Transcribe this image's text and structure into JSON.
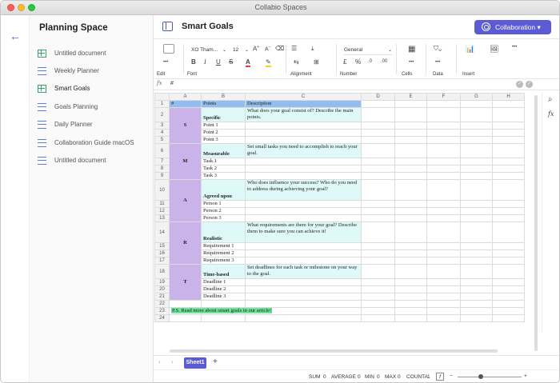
{
  "window": {
    "title": "Collabio Spaces"
  },
  "sidebar": {
    "title": "Planning Space",
    "items": [
      {
        "label": "Untitled document",
        "icon": "sheet-icon"
      },
      {
        "label": "Weekly Planner",
        "icon": "doc-icon"
      },
      {
        "label": "Smart Goals",
        "icon": "sheet-icon"
      },
      {
        "label": "Goals Planning",
        "icon": "doc-icon"
      },
      {
        "label": "Daily Planner",
        "icon": "doc-icon"
      },
      {
        "label": "Collaboration Guide macOS",
        "icon": "doc-icon"
      },
      {
        "label": "Untitled document",
        "icon": "doc-icon"
      }
    ]
  },
  "header": {
    "title": "Smart Goals",
    "collab_label": "Collaboration ▾"
  },
  "toolbar": {
    "edit": "Edit",
    "font": "Font",
    "alignment": "Alignment",
    "number": "Number",
    "cells": "Cells",
    "data": "Data",
    "insert": "Insert",
    "font_name": "XO Tham...",
    "font_size": "12",
    "number_format": "General",
    "bold": "B",
    "italic": "I",
    "underline": "U",
    "strike": "S",
    "currency": "£",
    "percent": "%",
    "decrease": ".0",
    "increase": ".00",
    "more": "•••"
  },
  "formula": {
    "label": "fx",
    "value": "#"
  },
  "grid": {
    "col_headers": [
      "A",
      "B",
      "C",
      "D",
      "E",
      "F",
      "G",
      "H"
    ],
    "rows": [
      {
        "n": "1",
        "a": "#",
        "b": "Points",
        "c": "Description"
      },
      {
        "n": "2",
        "a": "",
        "b": "Specific",
        "c": "What does your goal consist of? Describe the main points."
      },
      {
        "n": "3",
        "a": "S",
        "b": "Point 1",
        "c": ""
      },
      {
        "n": "4",
        "a": "",
        "b": "Point 2",
        "c": ""
      },
      {
        "n": "5",
        "a": "",
        "b": "Point 3",
        "c": ""
      },
      {
        "n": "6",
        "a": "",
        "b": "Measurable",
        "c": "Set small tasks you need to accomplish to reach your goal."
      },
      {
        "n": "7",
        "a": "M",
        "b": "Task 1",
        "c": ""
      },
      {
        "n": "8",
        "a": "",
        "b": "Task 2",
        "c": ""
      },
      {
        "n": "9",
        "a": "",
        "b": "Task 3",
        "c": ""
      },
      {
        "n": "10",
        "a": "A",
        "b": "Agreed upon",
        "c": "Who does influence your success? Who do you need to address during achieving your goal?"
      },
      {
        "n": "11",
        "a": "",
        "b": "Person 1",
        "c": ""
      },
      {
        "n": "12",
        "a": "",
        "b": "Person 2",
        "c": ""
      },
      {
        "n": "13",
        "a": "",
        "b": "Person 3",
        "c": ""
      },
      {
        "n": "14",
        "a": "R",
        "b": "Realistic",
        "c": "What requirements are there for your goal? Describe them to make sure you can achieve it!"
      },
      {
        "n": "15",
        "a": "",
        "b": "Requirement 1",
        "c": ""
      },
      {
        "n": "16",
        "a": "",
        "b": "Requirement 2",
        "c": ""
      },
      {
        "n": "17",
        "a": "",
        "b": "Requirement 3",
        "c": ""
      },
      {
        "n": "18",
        "a": "T",
        "b": "Time-based",
        "c": "Set deadlines for each task or milestone on your way to the goal."
      },
      {
        "n": "19",
        "a": "",
        "b": "Deadline 1",
        "c": ""
      },
      {
        "n": "20",
        "a": "",
        "b": "Deadline 2",
        "c": ""
      },
      {
        "n": "21",
        "a": "",
        "b": "Deadline 3",
        "c": ""
      },
      {
        "n": "22",
        "a": "",
        "b": "",
        "c": ""
      },
      {
        "n": "23",
        "a": "P.S. Read more about smart goals in our article!",
        "b": "",
        "c": ""
      },
      {
        "n": "24",
        "a": "",
        "b": "",
        "c": ""
      }
    ]
  },
  "sheets": {
    "active": "Sheet1",
    "add": "+"
  },
  "status": {
    "sum": "SUM",
    "sum_v": "0",
    "avg": "AVERAGE",
    "avg_v": "0",
    "min": "MIN",
    "min_v": "0",
    "max": "MAX",
    "max_v": "0",
    "counta": "COUNTA",
    "counta_v": "1"
  },
  "colors": {
    "accent": "#5b5bd6",
    "header_blue": "#93bdf0",
    "cyan": "#dff9f9",
    "purple": "#c9b3e8",
    "green": "#6fe39a"
  }
}
